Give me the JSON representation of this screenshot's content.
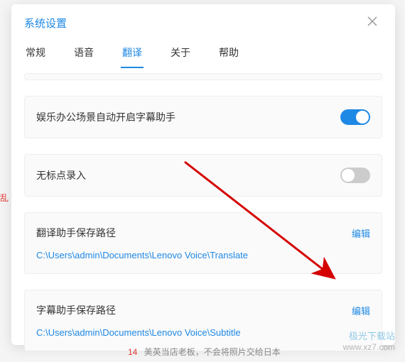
{
  "dialog": {
    "title": "系统设置"
  },
  "tabs": {
    "items": [
      {
        "label": "常规"
      },
      {
        "label": "语音"
      },
      {
        "label": "翻译"
      },
      {
        "label": "关于"
      },
      {
        "label": "帮助"
      }
    ],
    "active_index": 2
  },
  "settings": {
    "subtitle_auto": {
      "label": "娱乐办公场景自动开启字幕助手",
      "on": true
    },
    "no_punct": {
      "label": "无标点录入",
      "on": false
    },
    "translate_path": {
      "label": "翻译助手保存路径",
      "edit": "编辑",
      "path": "C:\\Users\\admin\\Documents\\Lenovo Voice\\Translate"
    },
    "subtitle_path": {
      "label": "字幕助手保存路径",
      "edit": "编辑",
      "path": "C:\\Users\\admin\\Documents\\Lenovo Voice\\Subtitle"
    }
  },
  "watermark": {
    "name": "极光下载站",
    "url": "www.xz7.com"
  },
  "background": {
    "left_edge": "乱",
    "bottom_num": "14",
    "bottom_text": "美英当店老板，不会将照片交给日本"
  },
  "colors": {
    "primary": "#1e88e5",
    "arrow": "#d50000"
  }
}
